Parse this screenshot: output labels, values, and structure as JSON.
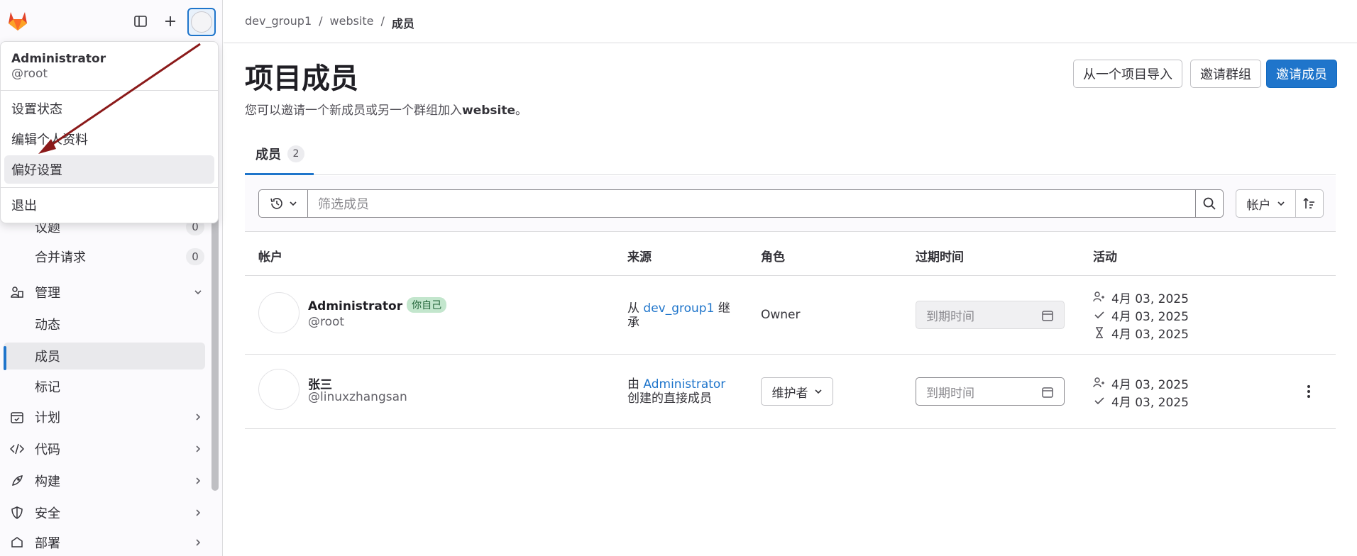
{
  "sidebar": {
    "nav": [
      {
        "label": "议题",
        "count": "0",
        "icon": "issues-icon"
      },
      {
        "label": "合并请求",
        "count": "0",
        "icon": "merge-request-icon"
      },
      {
        "label": "管理",
        "icon": "users-icon"
      },
      {
        "label": "动态"
      },
      {
        "label": "成员"
      },
      {
        "label": "标记"
      },
      {
        "label": "计划",
        "icon": "calendar-icon"
      },
      {
        "label": "代码",
        "icon": "code-icon"
      },
      {
        "label": "构建",
        "icon": "rocket-icon"
      },
      {
        "label": "安全",
        "icon": "shield-icon"
      },
      {
        "label": "部署",
        "icon": "deploy-icon"
      }
    ]
  },
  "user_menu": {
    "name": "Administrator",
    "handle": "@root",
    "items": [
      "设置状态",
      "编辑个人资料",
      "偏好设置",
      "退出"
    ]
  },
  "breadcrumb": [
    "dev_group1",
    "website",
    "成员"
  ],
  "page": {
    "title": "项目成员",
    "subtitle_prefix": "您可以邀请一个新成员或另一个群组加入",
    "subtitle_project": "website",
    "subtitle_suffix": "。",
    "buttons": {
      "import": "从一个项目导入",
      "invite_group": "邀请群组",
      "invite_members": "邀请成员"
    }
  },
  "tabs": [
    {
      "label": "成员",
      "count": "2"
    }
  ],
  "filter": {
    "placeholder": "筛选成员",
    "sort_label": "帐户"
  },
  "table": {
    "headers": [
      "帐户",
      "来源",
      "角色",
      "过期时间",
      "活动"
    ],
    "rows": [
      {
        "name": "Administrator",
        "badge": "你自己",
        "handle": "@root",
        "source_prefix": "从",
        "source_link": "dev_group1",
        "source_suffix": "继承",
        "role": "Owner",
        "expiry_placeholder": "到期时间",
        "activity": [
          "4月 03, 2025",
          "4月 03, 2025",
          "4月 03, 2025"
        ]
      },
      {
        "name": "张三",
        "handle": "@linuxzhangsan",
        "source_prefix": "由",
        "source_link": "Administrator",
        "source_suffix": "创建的直接成员",
        "role": "维护者",
        "expiry_placeholder": "到期时间",
        "activity": [
          "4月 03, 2025",
          "4月 03, 2025"
        ]
      }
    ]
  },
  "colors": {
    "primary": "#1f75cb",
    "annotation_arrow": "#8b1a1a"
  }
}
